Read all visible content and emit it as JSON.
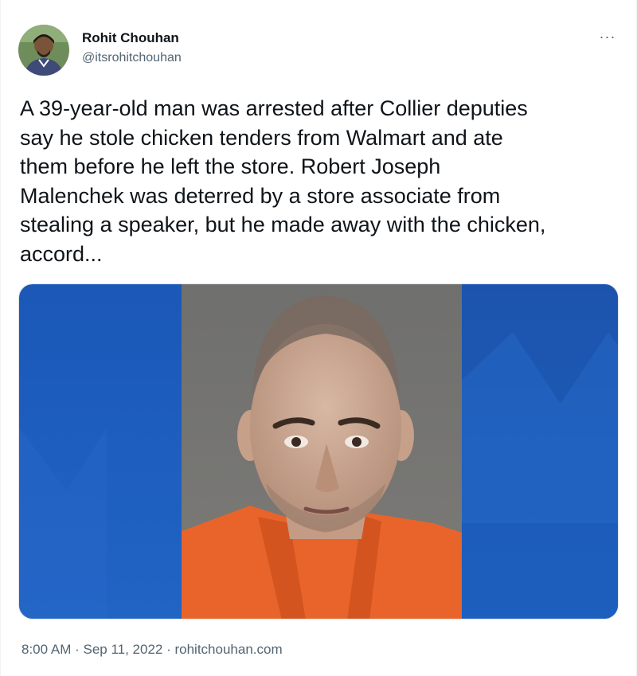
{
  "tweet": {
    "author_name": "Rohit Chouhan",
    "author_handle": "@itsrohitchouhan",
    "more_label": "···",
    "text": "A 39-year-old man was arrested after Collier deputies\nsay he stole chicken tenders from Walmart and ate\nthem before he left the store. Robert Joseph\nMalenchek was deterred by a store associate from\nstealing a speaker, but he made away with the chicken,\naccord...",
    "time": "8:00 AM",
    "separator": " · ",
    "date": "Sep 11, 2022",
    "source": "rohitchouhan.com"
  },
  "icons": {
    "avatar": "avatar-photo",
    "more": "more-options-icon",
    "media": "mugshot-photo"
  },
  "colors": {
    "primary_text": "#0f1419",
    "secondary_text": "#536471",
    "media_blue": "#1a4fa8",
    "jumpsuit_orange": "#e8642a"
  }
}
